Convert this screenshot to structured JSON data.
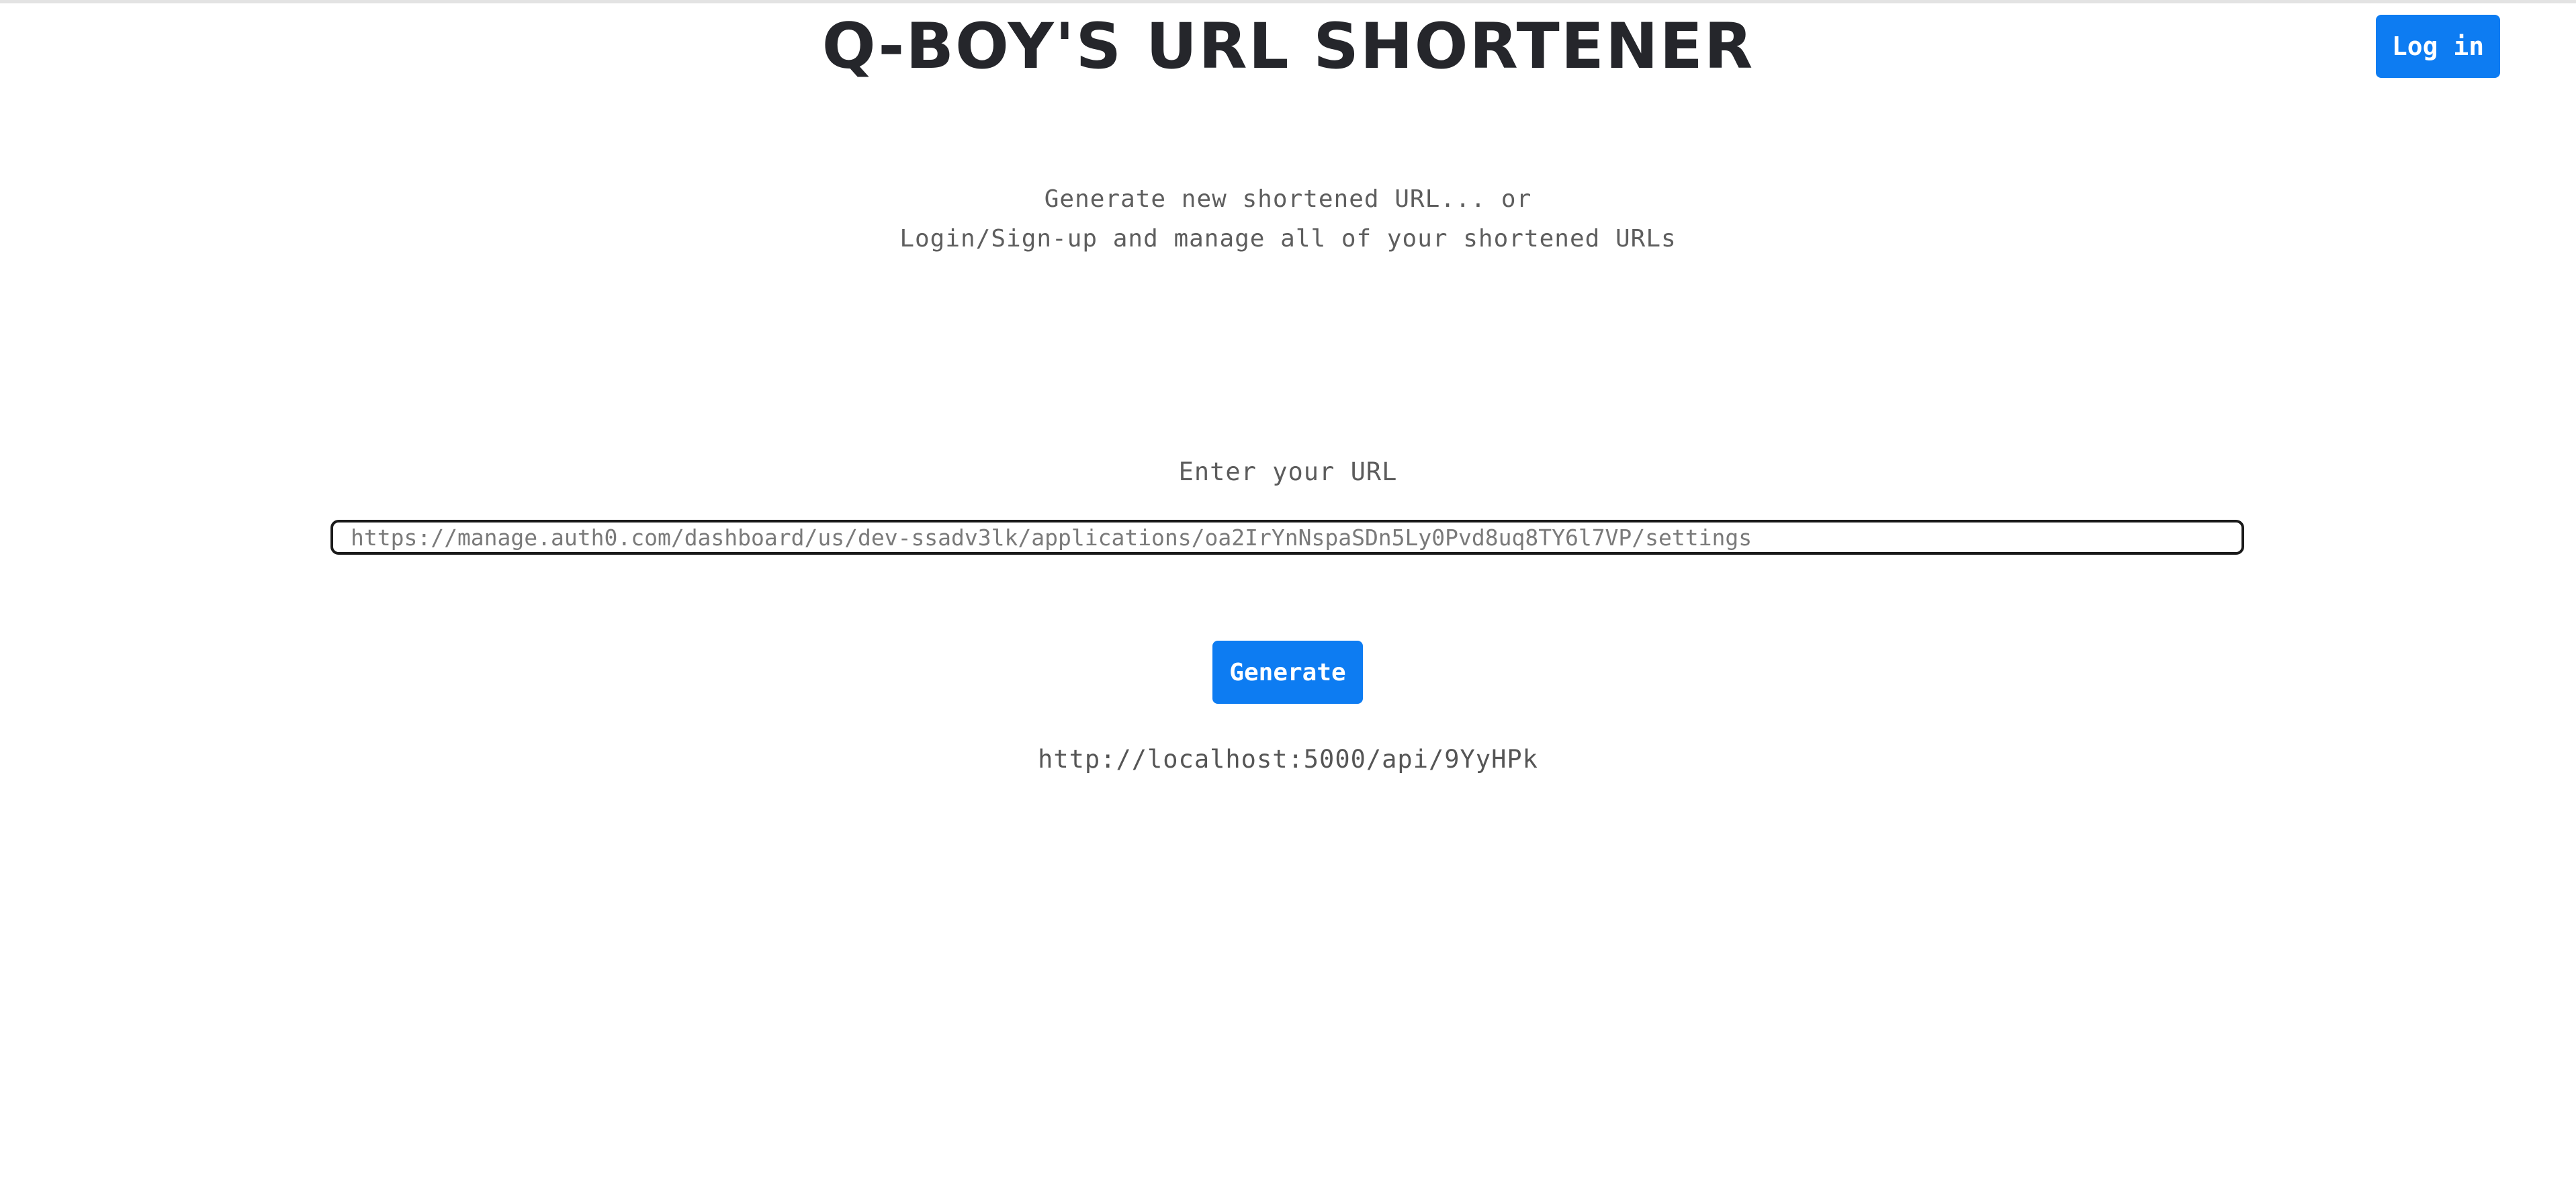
{
  "header": {
    "title": "Q-BOY'S URL SHORTENER",
    "login_label": "Log in"
  },
  "intro": {
    "line1": "Generate new shortened URL... or",
    "line2": "Login/Sign-up and manage all of your shortened URLs"
  },
  "form": {
    "label": "Enter your URL",
    "input_value": "https://manage.auth0.com/dashboard/us/dev-ssadv3lk/applications/oa2IrYnNspaSDn5Ly0Pvd8uq8TY6l7VP/settings",
    "generate_label": "Generate"
  },
  "result": {
    "short_url": "http://localhost:5000/api/9YyHPk"
  },
  "colors": {
    "accent": "#0d7cf2",
    "title": "#25262b",
    "text": "#5e5e5e"
  }
}
